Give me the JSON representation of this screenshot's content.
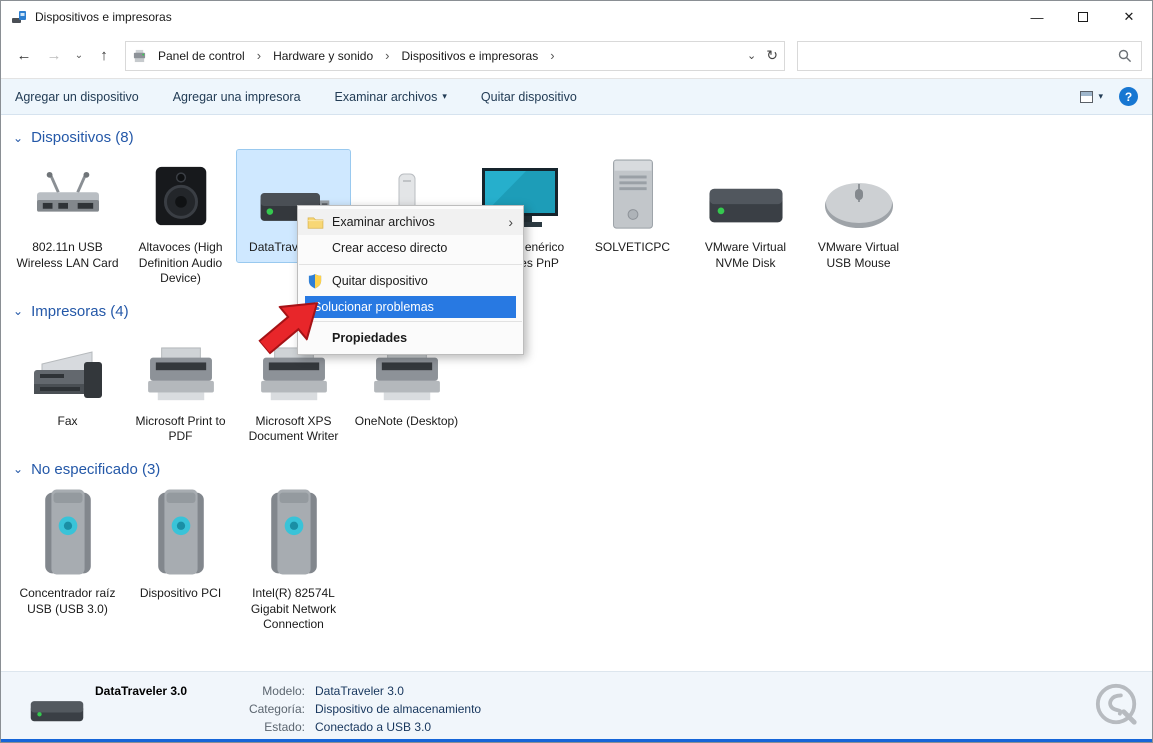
{
  "window": {
    "title": "Dispositivos e impresoras"
  },
  "icons": {
    "back": "←",
    "forward": "→",
    "up": "↑",
    "chevron_down": "⌄",
    "refresh": "↻",
    "caret_down": "▾",
    "submenu": "›",
    "crumb_sep": "›",
    "section_chevron": "⌄",
    "help": "?",
    "minimize": "—",
    "close": "✕"
  },
  "navbar": {
    "crumbs": [
      {
        "label": "Panel de control"
      },
      {
        "label": "Hardware y sonido"
      },
      {
        "label": "Dispositivos e impresoras"
      }
    ],
    "search_value": ""
  },
  "commandbar": {
    "items": [
      {
        "label": "Agregar un dispositivo"
      },
      {
        "label": "Agregar una impresora"
      },
      {
        "label": "Examinar archivos"
      },
      {
        "label": "Quitar dispositivo"
      }
    ]
  },
  "sections": [
    {
      "title": "Dispositivos (8)",
      "items": [
        {
          "label": "802.11n USB Wireless LAN Card",
          "icon": "wireless-lan-card-icon"
        },
        {
          "label": "Altavoces (High Definition Audio Device)",
          "icon": "speaker-icon"
        },
        {
          "label": "DataTraveler 3.0",
          "icon": "usb-flash-drive-icon",
          "selected": true
        },
        {
          "label": "",
          "icon": "usb-receiver-icon"
        },
        {
          "label": "Monitor genérico que no es PnP",
          "icon": "monitor-icon"
        },
        {
          "label": "SOLVETICPC",
          "icon": "pc-tower-icon"
        },
        {
          "label": "VMware Virtual NVMe Disk",
          "icon": "disk-drive-icon"
        },
        {
          "label": "VMware Virtual USB Mouse",
          "icon": "mouse-icon"
        }
      ]
    },
    {
      "title": "Impresoras (4)",
      "items": [
        {
          "label": "Fax",
          "icon": "fax-icon"
        },
        {
          "label": "Microsoft Print to PDF",
          "icon": "printer-icon"
        },
        {
          "label": "Microsoft XPS Document Writer",
          "icon": "printer-icon"
        },
        {
          "label": "OneNote (Desktop)",
          "icon": "printer-icon"
        }
      ]
    },
    {
      "title": "No especificado (3)",
      "items": [
        {
          "label": "Concentrador raíz USB (USB 3.0)",
          "icon": "generic-device-icon"
        },
        {
          "label": "Dispositivo PCI",
          "icon": "generic-device-icon"
        },
        {
          "label": "Intel(R) 82574L Gigabit Network Connection",
          "icon": "generic-device-icon"
        }
      ]
    }
  ],
  "context_menu": {
    "items": [
      {
        "label": "Examinar archivos",
        "icon": "folder-icon",
        "submenu": true
      },
      {
        "label": "Crear acceso directo"
      },
      {
        "label": "Quitar dispositivo",
        "icon": "uac-shield-icon"
      },
      {
        "label": "Solucionar problemas",
        "highlighted": true
      },
      {
        "label": "Propiedades",
        "bold": true
      }
    ]
  },
  "details": {
    "name": "DataTraveler 3.0",
    "rows": [
      {
        "label": "Modelo:",
        "value": "DataTraveler 3.0"
      },
      {
        "label": "Categoría:",
        "value": "Dispositivo de almacenamiento"
      },
      {
        "label": "Estado:",
        "value": "Conectado a USB 3.0"
      }
    ]
  },
  "colors": {
    "accent": "#2458a8",
    "menu_highlight": "#2879e2",
    "help_blue": "#1777d2",
    "arrow_red": "#e8262a"
  }
}
